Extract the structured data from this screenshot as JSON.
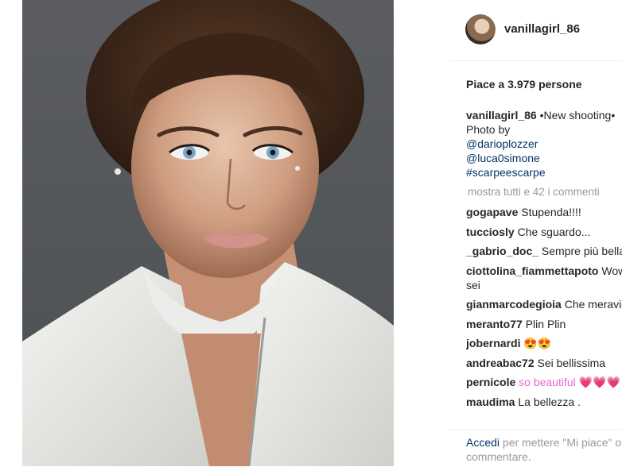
{
  "post": {
    "author": "vanillagirl_86",
    "likes_text": "Piace a 3.979 persone",
    "caption": {
      "author": "vanillagirl_86",
      "text": "•New shooting•",
      "line2": "Photo by",
      "links": [
        "@darioplozzer",
        "@luca0simone",
        "#scarpeescarpe"
      ]
    },
    "more_comments": "mostra tutti e 42 i commenti",
    "comments": [
      {
        "user": "gogapave",
        "text": "Stupenda!!!!"
      },
      {
        "user": "tucciosly",
        "text": "Che sguardo..."
      },
      {
        "user": "_gabrio_doc_",
        "text": "Sempre più bella"
      },
      {
        "user": "ciottolina_fiammettapoto",
        "text": "Wow",
        "text2": "sei"
      },
      {
        "user": "gianmarcodegioia",
        "text": "Che meravigli"
      },
      {
        "user": "meranto77",
        "text": "Plin Plin"
      },
      {
        "user": "jobernardi",
        "text": "😍😍"
      },
      {
        "user": "andreabac72",
        "text": "Sei bellissima"
      },
      {
        "user": "pernicole",
        "text": "so beautiful 💗💗💗"
      },
      {
        "user": "maudima",
        "text": "La bellezza ."
      }
    ],
    "footer": {
      "login_link": "Accedi",
      "text": "per mettere \"Mi piace\" o",
      "text2": "commentare."
    }
  }
}
